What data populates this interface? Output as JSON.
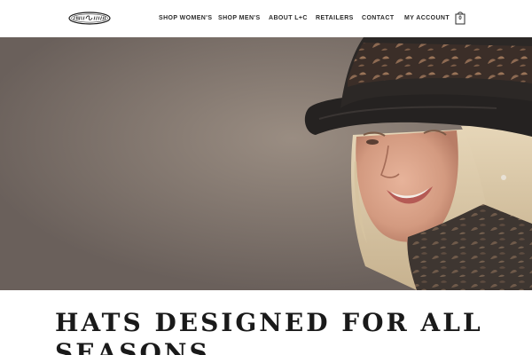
{
  "header": {
    "logo_text": "LILLIE & COHOE",
    "nav": [
      {
        "label": "SHOP WOMEN'S"
      },
      {
        "label": "SHOP MEN'S"
      },
      {
        "label": "ABOUT L+C"
      },
      {
        "label": "RETAILERS"
      },
      {
        "label": "CONTACT"
      },
      {
        "label": "MY ACCOUNT"
      }
    ],
    "cart_count": "0",
    "cart_icon": "shopping-bag-icon"
  },
  "hero": {
    "image": "smiling woman wearing black felt hat with brown floral band"
  },
  "main": {
    "headline": "HATS DESIGNED FOR ALL SEASONS"
  },
  "colors": {
    "text": "#2b2b2b",
    "background": "#ffffff",
    "hero_backdrop": "#85796f"
  }
}
